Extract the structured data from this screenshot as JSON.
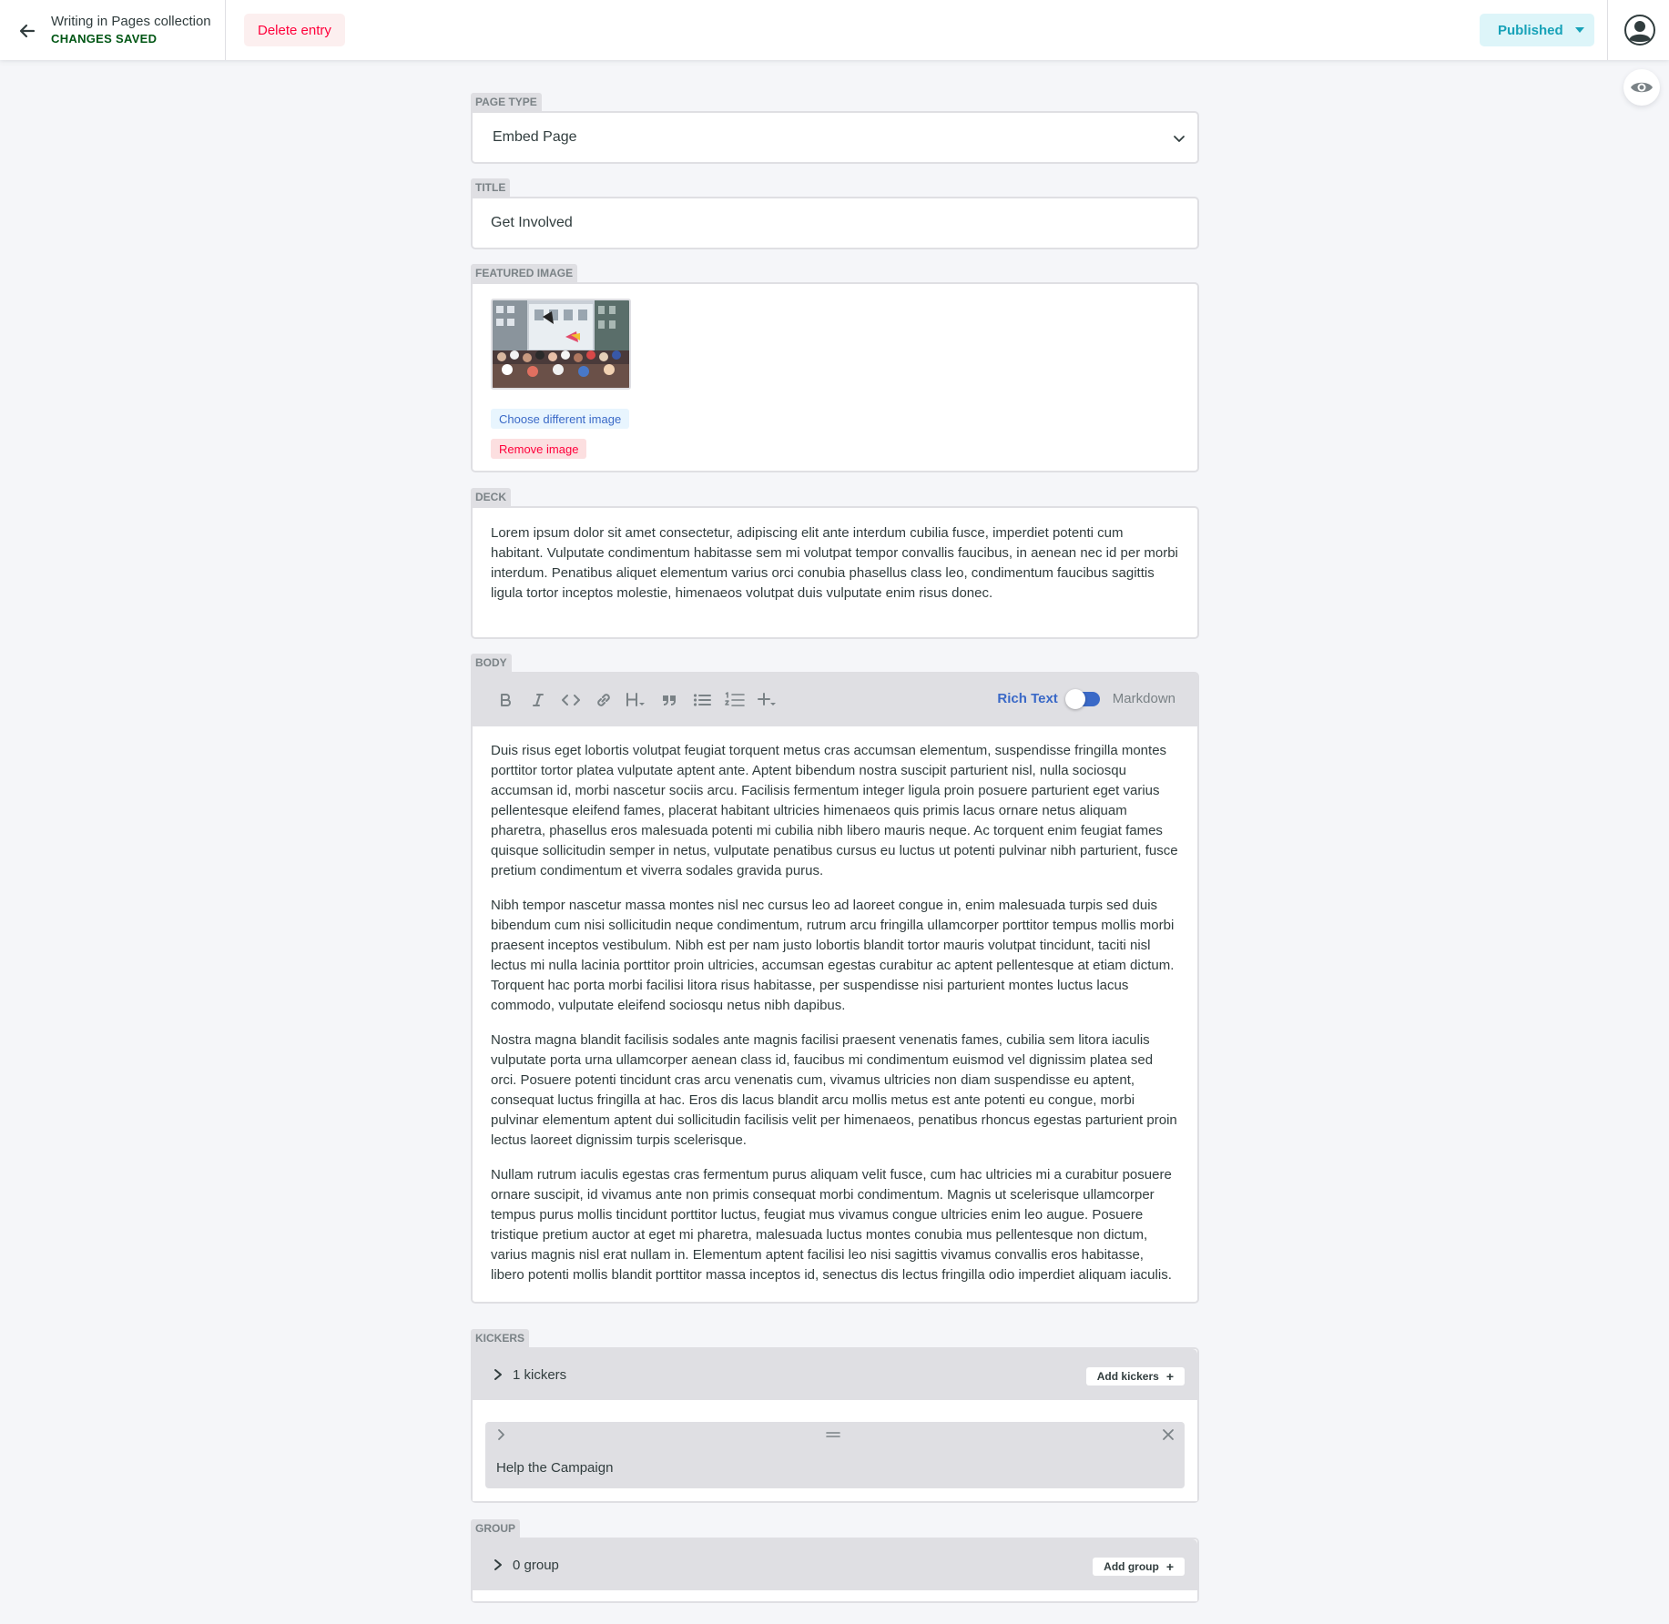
{
  "header": {
    "collection_title": "Writing in Pages collection",
    "status_text": "CHANGES SAVED",
    "delete_label": "Delete entry",
    "publish_status": "Published"
  },
  "colors": {
    "saved_green": "#005614",
    "danger_red": "#ff003b",
    "accent_blue": "#3a69c7",
    "published_teal": "#17a2b8"
  },
  "fields": {
    "page_type": {
      "label": "PAGE TYPE",
      "value": "Embed Page"
    },
    "title": {
      "label": "TITLE",
      "value": "Get Involved"
    },
    "featured_image": {
      "label": "FEATURED IMAGE",
      "choose_label": "Choose different image",
      "remove_label": "Remove image"
    },
    "deck": {
      "label": "DECK",
      "value": "Lorem ipsum dolor sit amet consectetur, adipiscing elit ante interdum cubilia fusce, imperdiet potenti cum habitant. Vulputate condimentum habitasse sem mi volutpat tempor convallis faucibus, in aenean nec id per morbi interdum. Penatibus aliquet elementum varius orci conubia phasellus class leo, condimentum faucibus sagittis ligula tortor inceptos molestie, himenaeos volutpat duis vulputate enim risus donec."
    },
    "body": {
      "label": "BODY",
      "toolbar": [
        "bold-icon",
        "italic-icon",
        "code-icon",
        "link-icon",
        "heading-icon",
        "quote-icon",
        "bulleted-list-icon",
        "numbered-list-icon",
        "add-component-icon"
      ],
      "mode_rich": "Rich Text",
      "mode_markdown": "Markdown",
      "paragraphs": [
        "Duis risus eget lobortis volutpat feugiat torquent metus cras accumsan elementum, suspendisse fringilla montes porttitor tortor platea vulputate aptent ante. Aptent bibendum nostra suscipit parturient nisl, nulla sociosqu accumsan id, morbi nascetur sociis arcu. Facilisis fermentum integer ligula proin posuere parturient eget varius pellentesque eleifend fames, placerat habitant ultricies himenaeos quis primis lacus ornare netus aliquam pharetra, phasellus eros malesuada potenti mi cubilia nibh libero mauris neque. Ac torquent enim feugiat fames quisque sollicitudin semper in netus, vulputate penatibus cursus eu luctus ut potenti pulvinar nibh parturient, fusce pretium condimentum et viverra sodales gravida purus.",
        "Nibh tempor nascetur massa montes nisl nec cursus leo ad laoreet congue in, enim malesuada turpis sed duis bibendum cum nisi sollicitudin neque condimentum, rutrum arcu fringilla ullamcorper porttitor tempus mollis morbi praesent inceptos vestibulum. Nibh est per nam justo lobortis blandit tortor mauris volutpat tincidunt, taciti nisl lectus mi nulla lacinia porttitor proin ultricies, accumsan egestas curabitur ac aptent pellentesque at etiam dictum. Torquent hac porta morbi facilisi litora risus habitasse, per suspendisse nisi parturient montes luctus lacus commodo, vulputate eleifend sociosqu netus nibh dapibus.",
        "Nostra magna blandit facilisis sodales ante magnis facilisi praesent venenatis fames, cubilia sem litora iaculis vulputate porta urna ullamcorper aenean class id, faucibus mi condimentum euismod vel dignissim platea sed orci. Posuere potenti tincidunt cras arcu venenatis cum, vivamus ultricies non diam suspendisse eu aptent, consequat luctus fringilla at hac. Eros dis lacus blandit arcu mollis metus est ante potenti eu congue, morbi pulvinar elementum aptent dui sollicitudin facilisis velit per himenaeos, penatibus rhoncus egestas parturient proin lectus laoreet dignissim turpis scelerisque.",
        "Nullam rutrum iaculis egestas cras fermentum purus aliquam velit fusce, cum hac ultricies mi a curabitur posuere ornare suscipit, id vivamus ante non primis consequat morbi condimentum. Magnis ut scelerisque ullamcorper tempus purus mollis tincidunt porttitor luctus, feugiat mus vivamus congue ultricies enim leo augue. Posuere tristique pretium auctor at eget mi pharetra, malesuada luctus montes conubia mus pellentesque non dictum, varius magnis nisl erat nullam in. Elementum aptent facilisi leo nisi sagittis vivamus convallis eros habitasse, libero potenti mollis blandit porttitor massa inceptos id, senectus dis lectus fringilla odio imperdiet aliquam iaculis."
      ]
    },
    "kickers": {
      "label": "KICKERS",
      "summary": "1 kickers",
      "add_label": "Add kickers",
      "items": [
        {
          "title": "Help the Campaign"
        }
      ]
    },
    "group": {
      "label": "GROUP",
      "summary": "0 group",
      "add_label": "Add group"
    }
  }
}
